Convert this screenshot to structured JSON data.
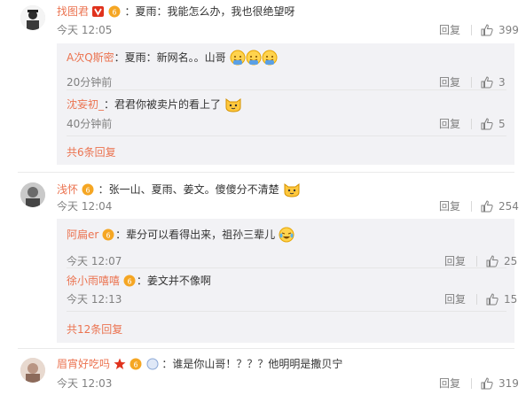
{
  "comments": [
    {
      "username": "找图君",
      "text": "：夏雨：我能怎么办，我也很绝望呀",
      "time": "今天 12:05",
      "reply_label": "回复",
      "likes": "399",
      "replies": [
        {
          "username": "A次Q斯密",
          "text": "：夏雨：新网名。。山哥",
          "time": "20分钟前",
          "reply_label": "回复",
          "likes": "3"
        },
        {
          "username": "沈妄初_",
          "text": "：君君你被卖片的看上了",
          "time": "40分钟前",
          "reply_label": "回复",
          "likes": "5"
        }
      ],
      "more_replies": "共6条回复"
    },
    {
      "username": "浅怀",
      "text": "：张一山、夏雨、姜文。傻傻分不清楚",
      "time": "今天 12:04",
      "reply_label": "回复",
      "likes": "254",
      "replies": [
        {
          "username": "阿扁er",
          "text": "：辈分可以看得出来，祖孙三辈儿",
          "time": "今天 12:07",
          "reply_label": "回复",
          "likes": "25"
        },
        {
          "username": "徐小雨嘻嘻",
          "text": "：姜文并不像啊",
          "time": "今天 12:13",
          "reply_label": "回复",
          "likes": "15"
        }
      ],
      "more_replies": "共12条回复"
    },
    {
      "username": "眉宵好吃吗",
      "text": "：谁是你山哥！？？？他明明是撒贝宁",
      "time": "今天 12:03",
      "reply_label": "回复",
      "likes": "319"
    }
  ],
  "colors": {
    "username": "#eb7350",
    "meta": "#808080",
    "reply_bg": "#f2f2f5",
    "vip_badge": "#f5a623",
    "verified": "#e0321d"
  }
}
